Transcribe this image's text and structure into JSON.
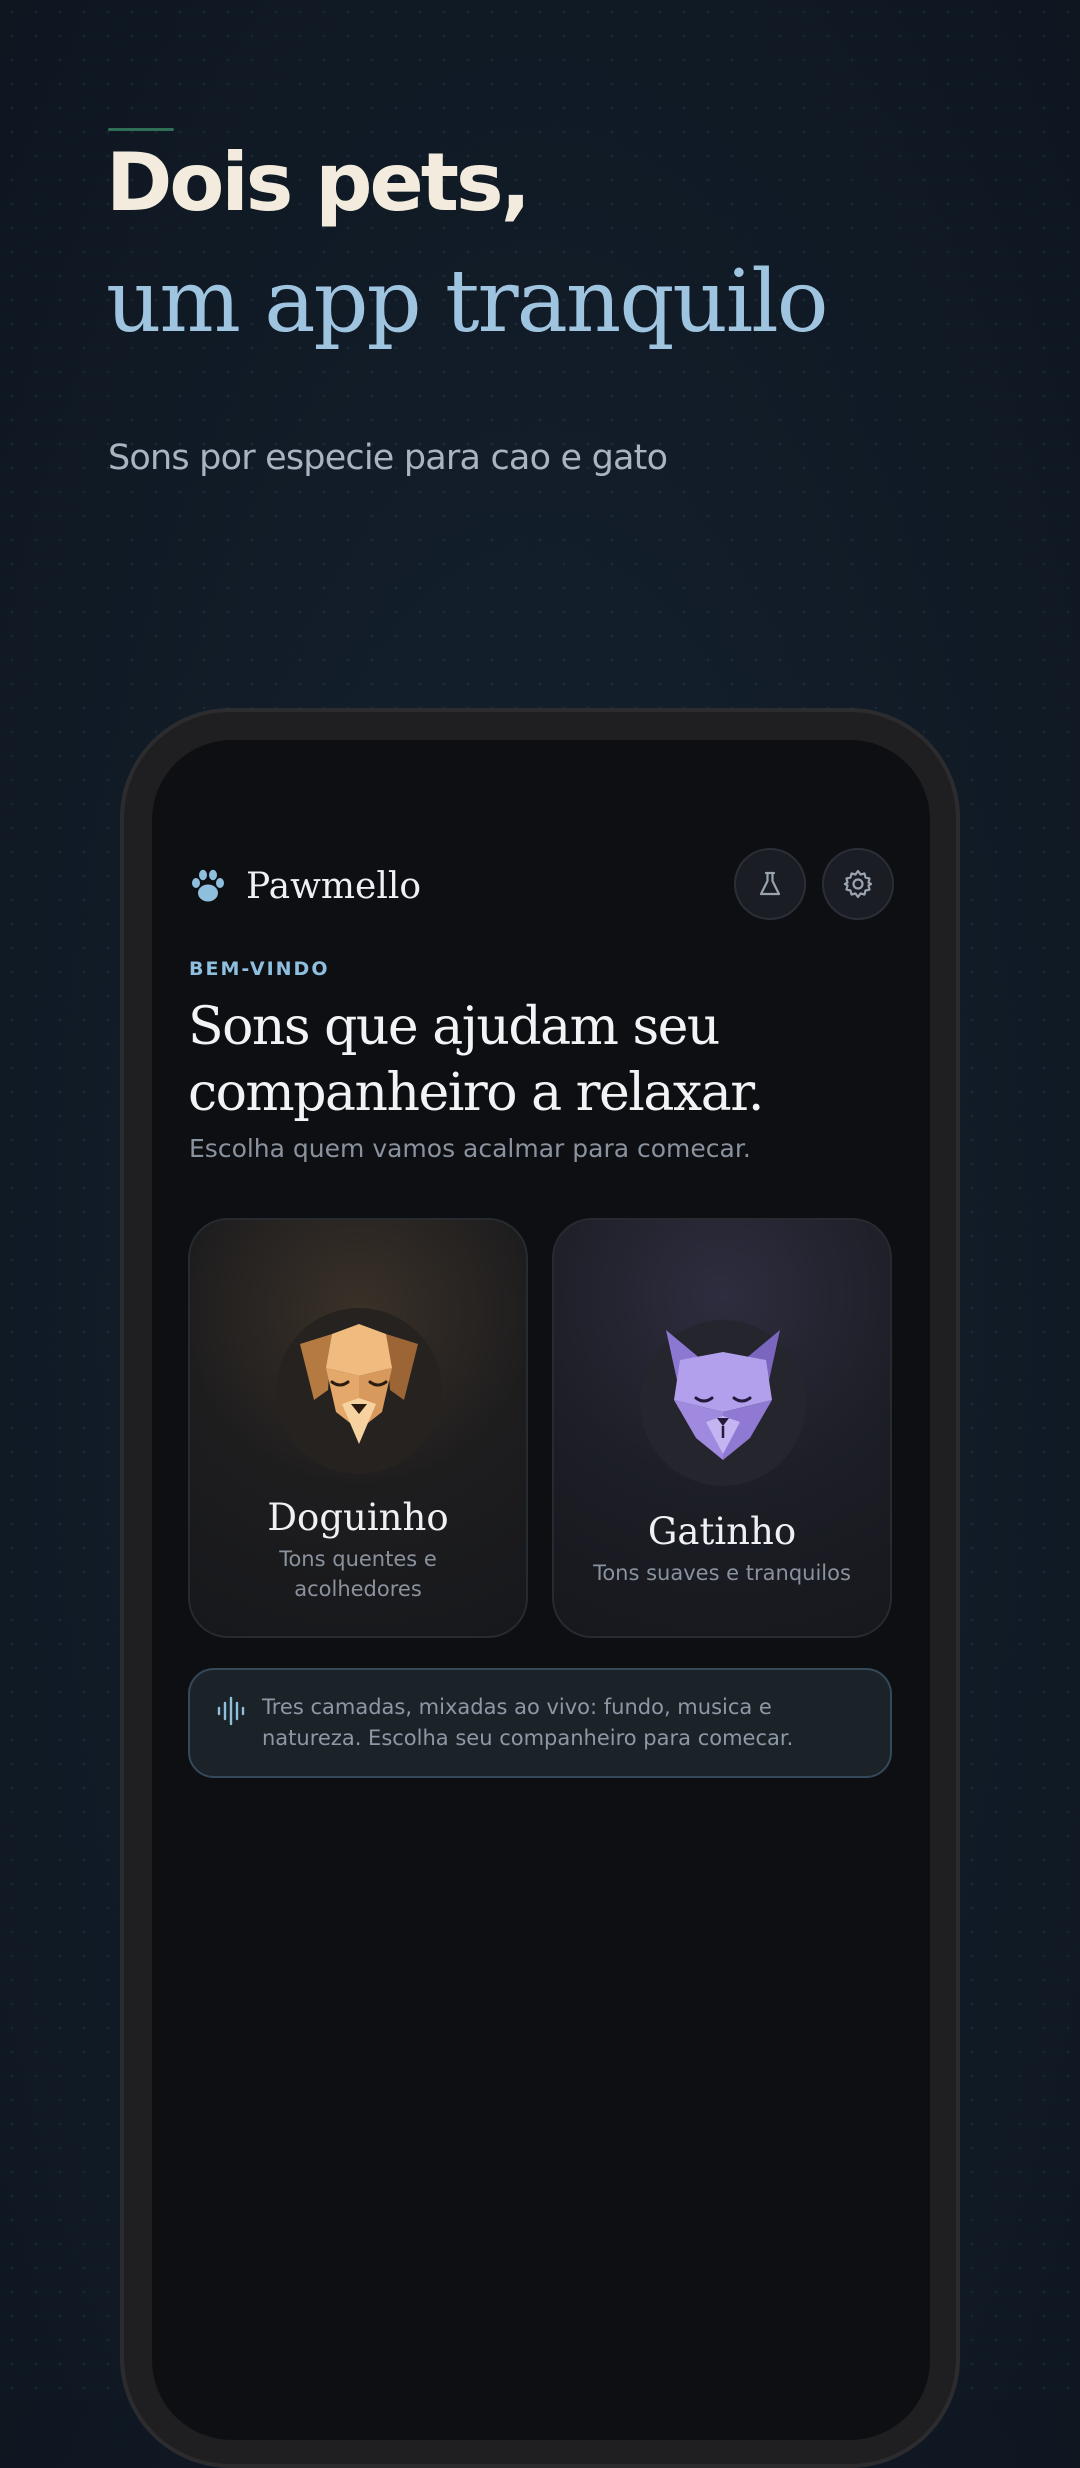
{
  "hero": {
    "title": "Dois pets,",
    "subtitle": "um app tranquilo",
    "tagline": "Sons por especie para cao e gato"
  },
  "app": {
    "brand": "Pawmello",
    "brand_icon": "paw-icon",
    "header_actions": [
      {
        "icon": "flask-icon"
      },
      {
        "icon": "gear-icon"
      }
    ],
    "welcome": {
      "eyebrow": "BEM-VINDO",
      "title": "Sons que ajudam seu companheiro a relaxar.",
      "subtitle": "Escolha quem vamos acalmar para comecar."
    },
    "pets": [
      {
        "name": "Doguinho",
        "description": "Tons quentes e acolhedores",
        "icon": "dog-face-icon",
        "accent": "#e0a56a"
      },
      {
        "name": "Gatinho",
        "description": "Tons suaves e tranquilos",
        "icon": "cat-face-icon",
        "accent": "#a48ee0"
      }
    ],
    "info": {
      "icon": "sound-wave-icon",
      "text": "Tres camadas, mixadas ao vivo: fundo, musica e natureza. Escolha seu companheiro para comecar."
    }
  },
  "colors": {
    "accent_blue": "#9ec4e0",
    "background": "#121d29",
    "screen": "#0d0f13"
  }
}
